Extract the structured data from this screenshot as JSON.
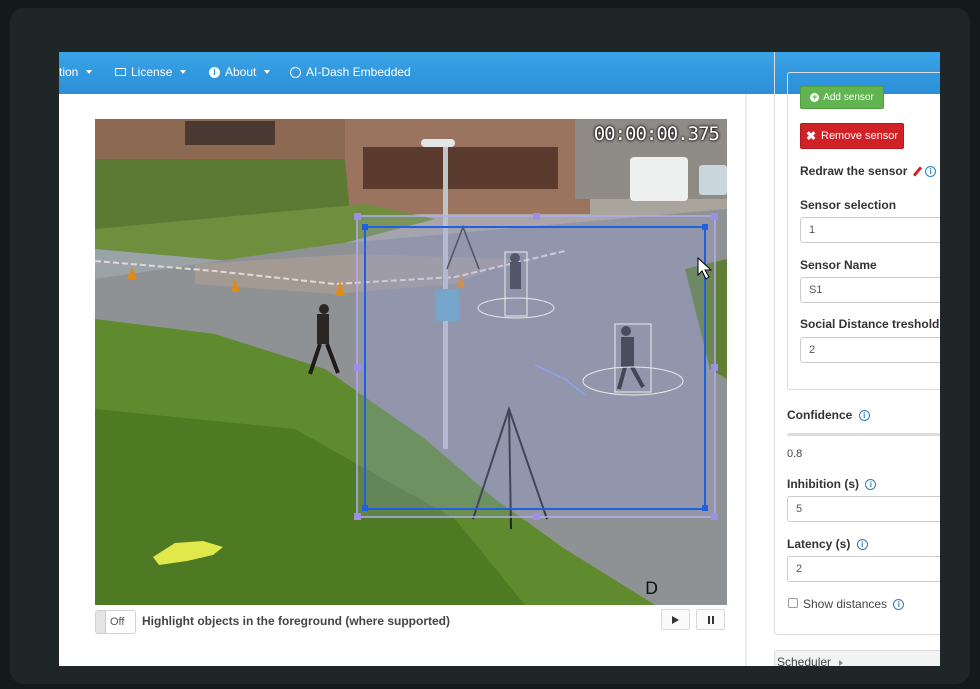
{
  "navbar": {
    "items": [
      {
        "label": "tion",
        "icon": "none",
        "has_caret": true
      },
      {
        "label": "License",
        "icon": "license-icon",
        "has_caret": true
      },
      {
        "label": "About",
        "icon": "info-icon",
        "has_caret": true
      },
      {
        "label": "AI-Dash Embedded",
        "icon": "power-icon",
        "has_caret": false
      }
    ],
    "color": "#2b8fd8"
  },
  "video": {
    "timecode": "00:00:00.375",
    "overlay_letter": "D",
    "sensor_box_color": "#1f5fe0",
    "outer_box_color": "#b0aef0"
  },
  "video_controls": {
    "toggle_label": "Off",
    "highlight_label": "Highlight objects in the foreground (where supported)"
  },
  "sensor_panel": {
    "add_sensor_label": "Add sensor",
    "remove_sensor_label": "Remove sensor",
    "redraw_label": "Redraw the sensor",
    "sensor_selection_label": "Sensor selection",
    "sensor_selection_value": "1",
    "sensor_name_label": "Sensor Name",
    "sensor_name_value": "S1",
    "social_distance_label": "Social Distance treshold (",
    "social_distance_value": "2"
  },
  "settings": {
    "confidence_label": "Confidence",
    "confidence_value": "0.8",
    "inhibition_label": "Inhibition (s)",
    "inhibition_value": "5",
    "latency_label": "Latency (s)",
    "latency_value": "2",
    "show_distances_label": "Show distances",
    "show_distances_checked": false
  },
  "scheduler": {
    "label": "Scheduler"
  },
  "colors": {
    "add": "#62b450",
    "remove": "#d02226",
    "info": "#2b7dc4"
  }
}
